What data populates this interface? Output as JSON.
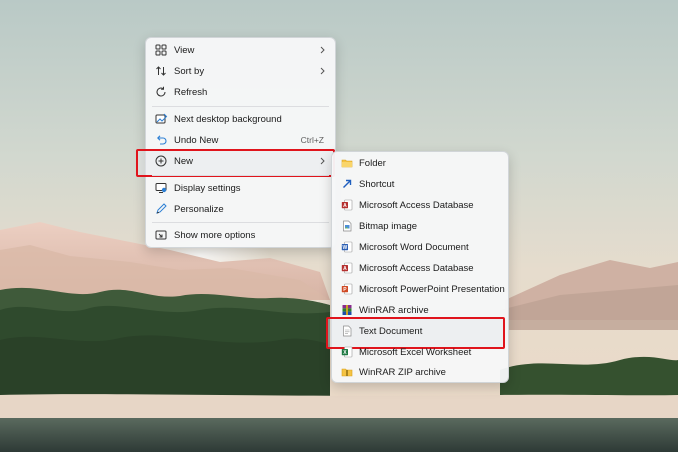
{
  "context_menu": {
    "items": [
      {
        "label": "View",
        "icon": "view-icon"
      },
      {
        "label": "Sort by",
        "icon": "sort-icon"
      },
      {
        "label": "Refresh",
        "icon": "refresh-icon"
      },
      {
        "label": "Next desktop background",
        "icon": "next-background-icon"
      },
      {
        "label": "Undo New",
        "icon": "undo-icon",
        "shortcut": "Ctrl+Z"
      },
      {
        "label": "New",
        "icon": "new-icon"
      },
      {
        "label": "Display settings",
        "icon": "display-icon"
      },
      {
        "label": "Personalize",
        "icon": "pen-icon"
      },
      {
        "label": "Show more options",
        "icon": "more-options-icon"
      }
    ]
  },
  "new_submenu": {
    "items": [
      {
        "label": "Folder",
        "icon": "folder-icon"
      },
      {
        "label": "Shortcut",
        "icon": "shortcut-icon"
      },
      {
        "label": "Microsoft Access Database",
        "icon": "access-icon"
      },
      {
        "label": "Bitmap image",
        "icon": "bitmap-icon"
      },
      {
        "label": "Microsoft Word Document",
        "icon": "word-icon"
      },
      {
        "label": "Microsoft Access Database",
        "icon": "access-icon"
      },
      {
        "label": "Microsoft PowerPoint Presentation",
        "icon": "powerpoint-icon"
      },
      {
        "label": "WinRAR archive",
        "icon": "winrar-icon"
      },
      {
        "label": "Text Document",
        "icon": "text-document-icon"
      },
      {
        "label": "Microsoft Excel Worksheet",
        "icon": "excel-icon"
      },
      {
        "label": "WinRAR ZIP archive",
        "icon": "winrar-zip-icon"
      }
    ]
  },
  "colors": {
    "highlight_border": "#e0141c",
    "menu_background": "#f6f7f8",
    "folder": "#f5c343",
    "word": "#2b5fb4",
    "access": "#b5302f",
    "powerpoint": "#d04a25",
    "excel": "#1f7a43"
  }
}
